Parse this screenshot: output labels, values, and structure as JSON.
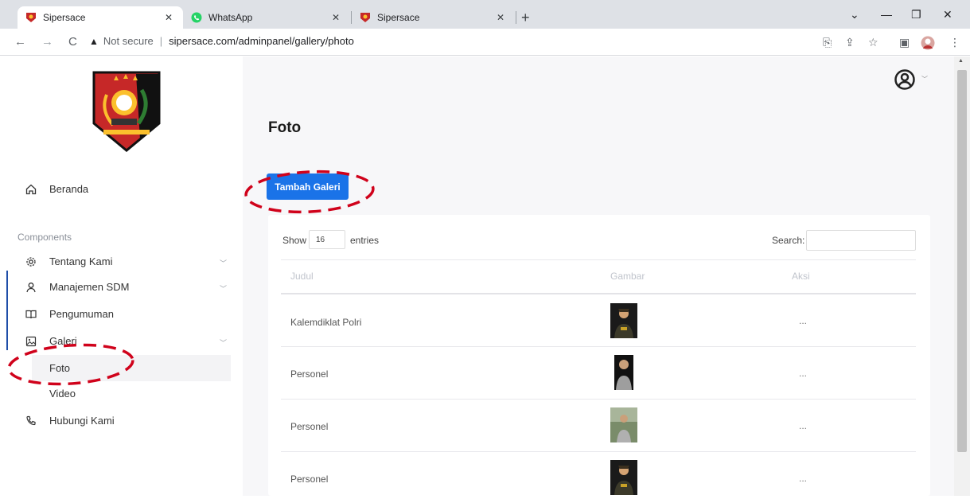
{
  "browser": {
    "tabs": [
      {
        "title": "Sipersace",
        "favicon": "shield-icon",
        "active": true
      },
      {
        "title": "WhatsApp",
        "favicon": "whatsapp-icon",
        "active": false
      },
      {
        "title": "Sipersace",
        "favicon": "shield-icon",
        "active": false
      }
    ],
    "security_label": "Not secure",
    "url": "sipersace.com/adminpanel/gallery/photo"
  },
  "sidebar": {
    "home_label": "Beranda",
    "section_label": "Components",
    "items": [
      {
        "label": "Tentang Kami",
        "icon": "gear-icon",
        "has_children": true
      },
      {
        "label": "Manajemen SDM",
        "icon": "user-icon",
        "has_children": true
      },
      {
        "label": "Pengumuman",
        "icon": "book-icon",
        "has_children": false
      },
      {
        "label": "Galeri",
        "icon": "image-icon",
        "has_children": true
      },
      {
        "label": "Hubungi Kami",
        "icon": "phone-icon",
        "has_children": false
      }
    ],
    "galeri_children": [
      {
        "label": "Foto",
        "active": true
      },
      {
        "label": "Video",
        "active": false
      }
    ]
  },
  "main": {
    "page_title": "Foto",
    "add_button_label": "Tambah Galeri",
    "table_controls": {
      "show_label": "Show",
      "entries_value": "16",
      "entries_label": "entries",
      "search_label": "Search:"
    },
    "table": {
      "headers": [
        "Judul",
        "Gambar",
        "Aksi"
      ],
      "rows": [
        {
          "judul": "Kalemdiklat Polri",
          "aksi": "..."
        },
        {
          "judul": "Personel",
          "aksi": "..."
        },
        {
          "judul": "Personel",
          "aksi": "..."
        },
        {
          "judul": "Personel",
          "aksi": "..."
        }
      ]
    }
  },
  "colors": {
    "primary_button": "#1a73e8",
    "annotation": "#d0021b",
    "active_indicator": "#1f4ea8"
  }
}
